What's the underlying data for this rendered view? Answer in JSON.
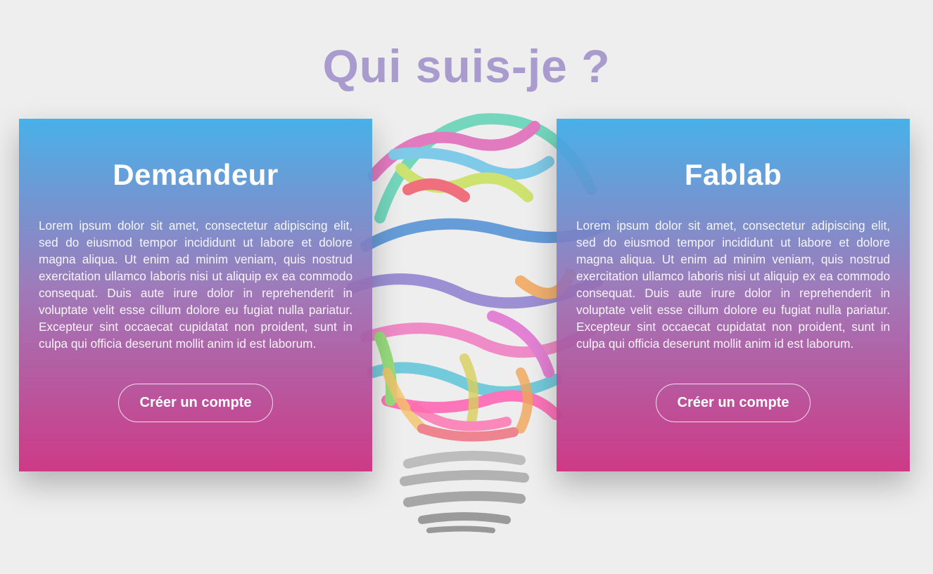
{
  "page": {
    "title": "Qui suis-je ?"
  },
  "cards": [
    {
      "title": "Demandeur",
      "text": "Lorem ipsum dolor sit amet, consectetur adipiscing elit, sed do eiusmod tempor incididunt ut labore et dolore magna aliqua. Ut enim ad minim veniam, quis nostrud exercitation ullamco laboris nisi ut aliquip ex ea commodo consequat. Duis aute irure dolor in reprehenderit in voluptate velit esse cillum dolore eu fugiat nulla pariatur. Excepteur sint occaecat cupidatat non proident, sunt in culpa qui officia deserunt mollit anim id est laborum.",
      "button_label": "Créer un compte"
    },
    {
      "title": "Fablab",
      "text": "Lorem ipsum dolor sit amet, consectetur adipiscing elit, sed do eiusmod tempor incididunt ut labore et dolore magna aliqua. Ut enim ad minim veniam, quis nostrud exercitation ullamco laboris nisi ut aliquip ex ea commodo consequat. Duis aute irure dolor in reprehenderit in voluptate velit esse cillum dolore eu fugiat nulla pariatur. Excepteur sint occaecat cupidatat non proident, sunt in culpa qui officia deserunt mollit anim id est laborum.",
      "button_label": "Créer un compte"
    }
  ],
  "background_image": {
    "icon": "lightbulb-illustration"
  },
  "colors": {
    "title": "#a99bcd",
    "gradient_top": "#3cace8",
    "gradient_bottom": "#cd3282",
    "background": "#eeeeee"
  }
}
